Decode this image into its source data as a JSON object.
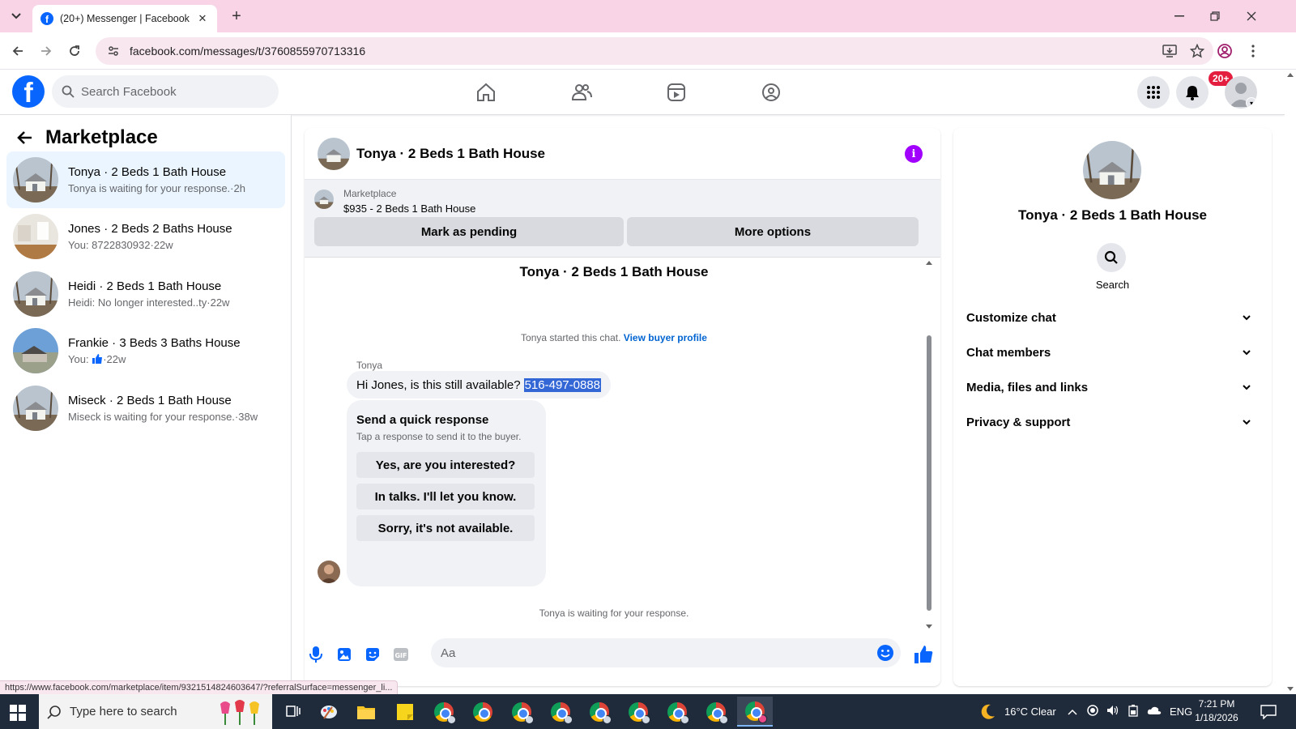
{
  "browser": {
    "tab_title": "(20+) Messenger | Facebook",
    "url": "facebook.com/messages/t/3760855970713316",
    "status_url": "https://www.facebook.com/marketplace/item/9321514824603647/?referralSurface=messenger_li..."
  },
  "fbnav": {
    "search_placeholder": "Search Facebook",
    "notification_badge": "20+",
    "brand_color": "#0866ff"
  },
  "sidebar": {
    "title": "Marketplace",
    "conversations": [
      {
        "name": "Tonya · 2 Beds 1 Bath House",
        "preview": "Tonya is waiting for your response.·2h",
        "active": true
      },
      {
        "name": "Jones · 2 Beds 2 Baths House",
        "preview": "You: 8722830932·22w",
        "active": false
      },
      {
        "name": "Heidi · 2 Beds 1 Bath House",
        "preview": "Heidi: No longer interested..ty·22w",
        "active": false
      },
      {
        "name": "Frankie · 3 Beds 3 Baths House",
        "preview_prefix": "You:",
        "preview_suffix": "·22w",
        "active": false
      },
      {
        "name": "Miseck · 2 Beds 1 Bath House",
        "preview": "Miseck is waiting for your response.·38w",
        "active": false
      }
    ]
  },
  "chat": {
    "header_title": "Tonya · 2 Beds 1 Bath House",
    "marketplace_label": "Marketplace",
    "listing": "$935 - 2 Beds 1 Bath House",
    "mark_pending_label": "Mark as pending",
    "more_options_label": "More options",
    "thread_title": "Tonya · 2 Beds 1 Bath House",
    "started_text": "Tonya started this chat.",
    "view_buyer_profile": "View buyer profile",
    "sender_name": "Tonya",
    "message_text": "Hi Jones, is this still available?",
    "message_phone": "516-497-0888",
    "quick_response_title": "Send a quick response",
    "quick_response_subtitle": "Tap a response to send it to the buyer.",
    "quick_responses": [
      "Yes, are you interested?",
      "In talks. I'll let you know.",
      "Sorry, it's not available."
    ],
    "waiting_text": "Tonya is waiting for your response.",
    "composer_placeholder": "Aa",
    "accent_color": "#0866ff",
    "info_color": "#a100ff"
  },
  "info_panel": {
    "name": "Tonya · 2 Beds 1 Bath House",
    "search_label": "Search",
    "sections": [
      "Customize chat",
      "Chat members",
      "Media, files and links",
      "Privacy & support"
    ]
  },
  "taskbar": {
    "search_placeholder": "Type here to search",
    "weather": "16°C  Clear",
    "language": "ENG",
    "time": "7:21 PM",
    "date": "1/18/2026"
  }
}
